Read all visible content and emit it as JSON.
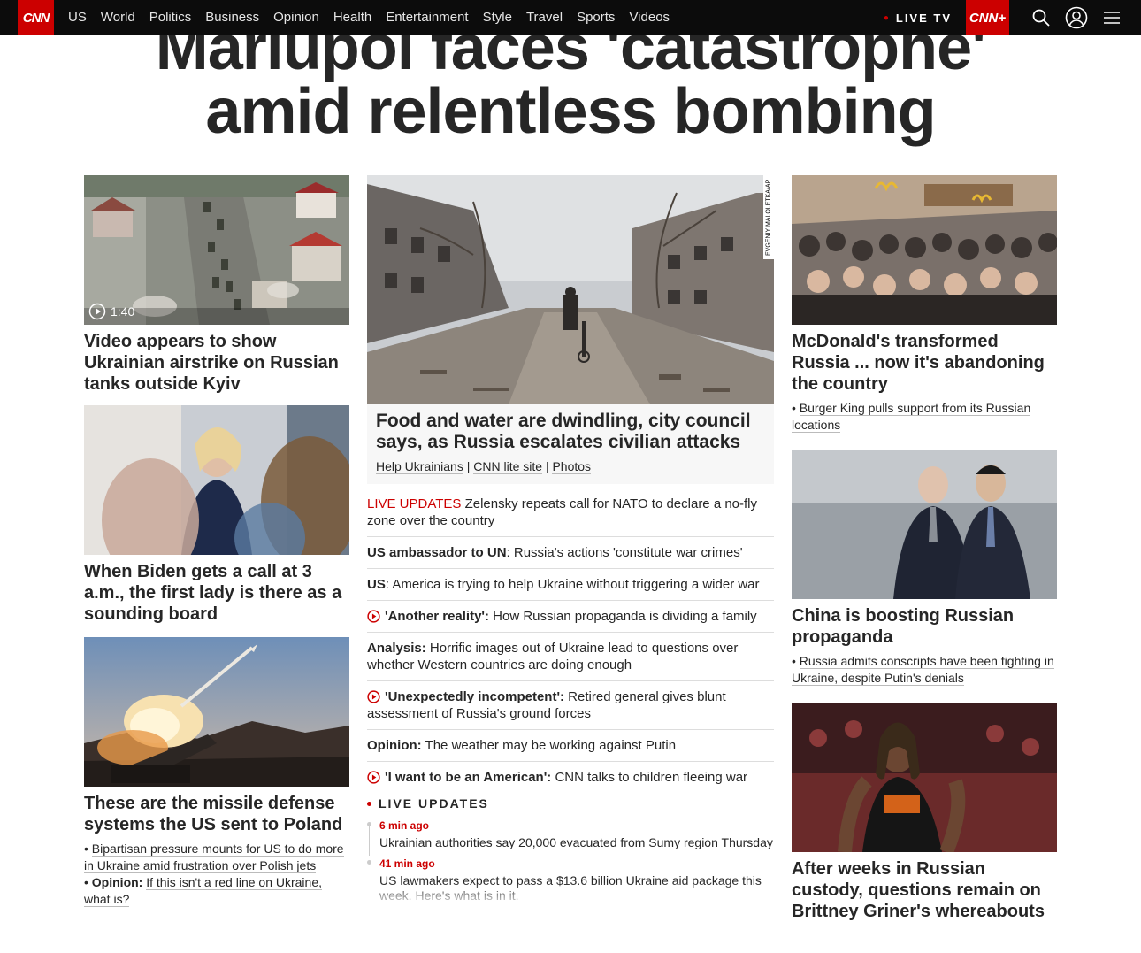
{
  "nav": {
    "logo": "CNN",
    "links": [
      "US",
      "World",
      "Politics",
      "Business",
      "Opinion",
      "Health",
      "Entertainment",
      "Style",
      "Travel",
      "Sports",
      "Videos"
    ],
    "live_tv": "LIVE TV",
    "cnn_plus": "CNN+"
  },
  "headline": {
    "line1": "Mariupol faces 'catastrophe'",
    "line2": "amid relentless bombing"
  },
  "left": {
    "video_card": {
      "duration": "1:40",
      "title": "Video appears to show Ukrainian airstrike on Russian tanks outside Kyiv"
    },
    "biden_card": {
      "title": "When Biden gets a call at 3 a.m., the first lady is there as a sounding board"
    },
    "missile_card": {
      "title": "These are the missile defense systems the US sent to Poland",
      "sub1": "Bipartisan pressure mounts for US to do more in Ukraine amid frustration over Polish jets",
      "sub2_label": "Opinion:",
      "sub2": "If this isn't a red line on Ukraine, what is?"
    }
  },
  "middle": {
    "hero": {
      "credit": "EVGENIY MALOLETKA/AP",
      "title": "Food and water are dwindling, city council says, as Russia escalates civilian attacks",
      "links": [
        "Help Ukrainians",
        "CNN lite site",
        "Photos"
      ],
      "sep": "|"
    },
    "list": [
      {
        "prefix": "LIVE UPDATES",
        "text": " Zelensky repeats call for NATO to declare a no-fly zone over the country"
      },
      {
        "prefix": "US ambassador to UN",
        "text": ": Russia's actions 'constitute war crimes'"
      },
      {
        "prefix": "US",
        "text": ": America is trying to help Ukraine without triggering a wider war"
      },
      {
        "prefix": "'Another reality':",
        "text": " How Russian propaganda is dividing a family"
      },
      {
        "prefix": "Analysis:",
        "text": " Horrific images out of Ukraine lead to questions over whether Western countries are doing enough"
      },
      {
        "prefix": "'Unexpectedly incompetent':",
        "text": " Retired general gives blunt assessment of Russia's ground forces"
      },
      {
        "prefix": "Opinion:",
        "text": " The weather may be working against Putin"
      },
      {
        "prefix": "'I want to be an American':",
        "text": " CNN talks to children fleeing war"
      }
    ],
    "live": {
      "heading": "LIVE UPDATES",
      "entries": [
        {
          "time": "6 min ago",
          "text": "Ukrainian authorities say 20,000 evacuated from Sumy region Thursday"
        },
        {
          "time": "41 min ago",
          "text": "US lawmakers expect to pass a $13.6 billion Ukraine aid package this week. Here's what is in it."
        }
      ]
    }
  },
  "right": {
    "mcd_card": {
      "title": "McDonald's transformed Russia ... now it's abandoning the country",
      "sub": "Burger King pulls support from its Russian locations"
    },
    "china_card": {
      "title": "China is boosting Russian propaganda",
      "sub": "Russia admits conscripts have been fighting in Ukraine, despite Putin's denials"
    },
    "griner_card": {
      "title": "After weeks in Russian custody, questions remain on Brittney Griner's whereabouts"
    }
  }
}
